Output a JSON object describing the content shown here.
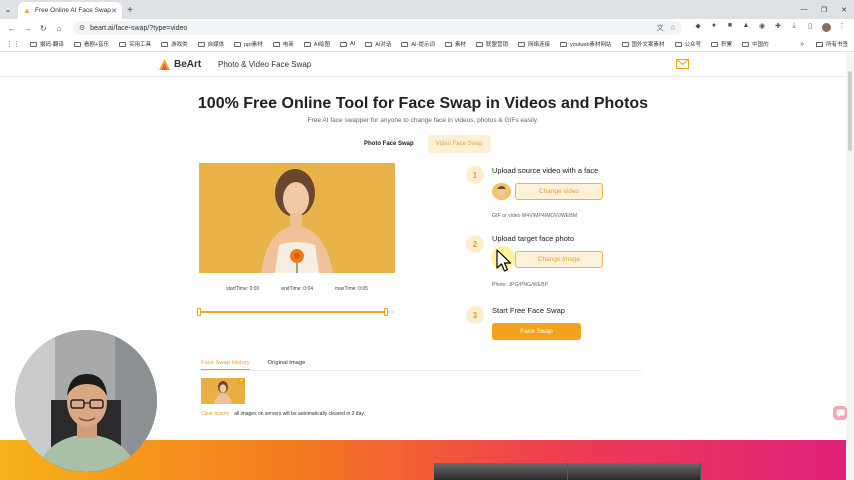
{
  "browser": {
    "tab_title": "Free Online AI Face Swap Fo",
    "url": "beart.ai/face-swap/?type=video",
    "bookmarks": [
      "摄码·翻译",
      "看剧+音乐",
      "实用工具",
      "游戏类",
      "自媒体",
      "ppt素材",
      "电商",
      "AI绘图",
      "AI",
      "AI对话",
      "AI-提示词",
      "素材",
      "联盟营销",
      "网络连接",
      "youtueb素材网站",
      "国外文案素材",
      "公众号",
      "积累",
      "中国的"
    ],
    "bookmarks_all": "所有书签"
  },
  "site": {
    "brand": "BeArt",
    "nav_link": "Photo & Video Face Swap",
    "title": "100% Free Online Tool for Face Swap in Videos and Photos",
    "subtitle": "Free AI face swapper for anyone to change face in videos, photos & GIFs easily.",
    "mode_tabs": {
      "photo": "Photo Face Swap",
      "video": "Video Face Swap"
    }
  },
  "preview": {
    "start_time": "startTime: 0:00",
    "end_time": "endTime: 0:04",
    "max_time": "maxTime: 0:05",
    "range_start": 0.0,
    "range_end": 0.96
  },
  "steps": [
    {
      "num": "1",
      "title": "Upload source video with a face",
      "button": "Change video",
      "hint": "GIF or video M4V/MP4/MOV//WEBM"
    },
    {
      "num": "2",
      "title": "Upload target face photo",
      "button": "Change image",
      "hint": "Photo: JPG/PNG/WEBP"
    },
    {
      "num": "3",
      "title": "Start Free Face Swap",
      "button": "Face Swap"
    }
  ],
  "history": {
    "tab_active": "Face Swap History",
    "tab_other": "Original Image",
    "clear_link": "Clear history",
    "clear_note": "all images on servers will be automatically cleared in 2 day.",
    "close_glyph": "×"
  },
  "colors": {
    "accent": "#f3a21a",
    "accent_soft": "#fdf1da",
    "preview_bg": "#e8b348"
  },
  "icons": [
    "chrome-menu-icon",
    "back-icon",
    "forward-icon",
    "reload-icon",
    "home-icon",
    "translate-icon",
    "star-icon",
    "mail-icon",
    "chat-icon",
    "cursor-icon"
  ]
}
